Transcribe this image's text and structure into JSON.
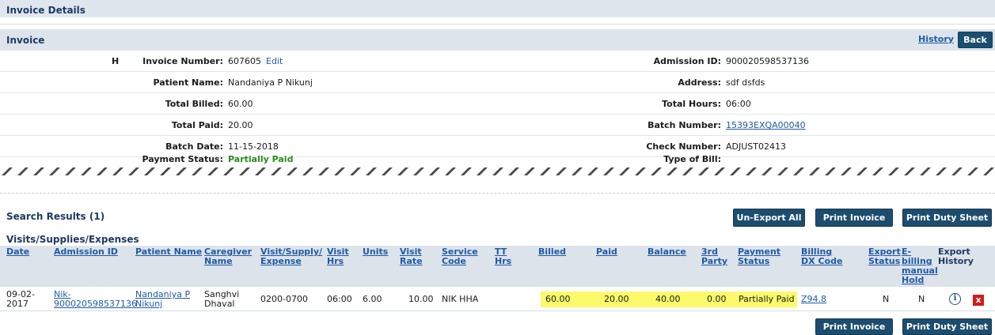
{
  "header": {
    "title": "Invoice Details"
  },
  "invoice_panel": {
    "title": "Invoice",
    "history_link": "History",
    "back_button": "Back"
  },
  "details": {
    "h_mark": "H",
    "invoice_number_label": "Invoice Number:",
    "invoice_number": "607605",
    "edit_link": "Edit",
    "admission_id_label": "Admission ID:",
    "admission_id": "900020598537136",
    "patient_name_label": "Patient Name:",
    "patient_name": "Nandaniya P Nikunj",
    "address_label": "Address:",
    "address": "sdf dsfds",
    "total_billed_label": "Total Billed:",
    "total_billed": "60.00",
    "total_hours_label": "Total Hours:",
    "total_hours": "06:00",
    "total_paid_label": "Total Paid:",
    "total_paid": "20.00",
    "batch_number_label": "Batch Number:",
    "batch_number": "15393EXQA00040",
    "batch_date_label": "Batch Date:",
    "batch_date": "11-15-2018",
    "check_number_label": "Check Number:",
    "check_number": "ADJUST02413",
    "payment_status_label": "Payment Status:",
    "payment_status": "Partially Paid",
    "type_of_bill_label": "Type of Bill:",
    "type_of_bill": ""
  },
  "search": {
    "title": "Search Results",
    "count": "(1)",
    "unexport_all": "Un-Export All",
    "print_invoice": "Print Invoice",
    "print_duty_sheet": "Print Duty Sheet"
  },
  "grid": {
    "section_title": "Visits/Supplies/Expenses",
    "headers": {
      "date": "Date",
      "admission_id": "Admission ID",
      "patient_name": "Patient Name",
      "caregiver_1": "Caregiver",
      "caregiver_2": "Name",
      "visit_supply_1": "Visit/Supply/",
      "visit_supply_2": "Expense",
      "visit_hrs_1": "Visit",
      "visit_hrs_2": "Hrs",
      "units": "Units",
      "visit_rate_1": "Visit",
      "visit_rate_2": "Rate",
      "service_code_1": "Service",
      "service_code_2": "Code",
      "tt_hrs_1": "TT",
      "tt_hrs_2": "Hrs",
      "billed": "Billed",
      "paid": "Paid",
      "balance": "Balance",
      "third_party_1": "3rd",
      "third_party_2": "Party",
      "payment_status_1": "Payment",
      "payment_status_2": "Status",
      "billing_dx_1": "Billing",
      "billing_dx_2": "DX Code",
      "export_status_1": "Export",
      "export_status_2": "Status",
      "ebilling_1": "E-",
      "ebilling_2": "billing",
      "ebilling_3": "manual",
      "ebilling_4": "Hold",
      "export_history_1": "Export",
      "export_history_2": "History"
    },
    "row": {
      "date_1": "09-02-",
      "date_2": "2017",
      "admission_id_1": "Nik-",
      "admission_id_2": "900020598537136",
      "patient_1": "Nandaniya P",
      "patient_2": "Nikunj",
      "caregiver_1": "Sanghvi",
      "caregiver_2": "Dhaval",
      "visit_supply": "0200-0700",
      "visit_hrs": "06:00",
      "units": "6.00",
      "visit_rate": "10.00",
      "service_code": "NIK HHA",
      "tt_hrs": "",
      "billed": "60.00",
      "paid": "20.00",
      "balance": "40.00",
      "third_party": "0.00",
      "payment_status": "Partially Paid",
      "billing_dx": "Z94.8",
      "export_status": "N",
      "ebilling_hold": "N",
      "info_icon": "i",
      "delete_icon": "x"
    }
  },
  "footer": {
    "print_invoice": "Print Invoice",
    "print_duty_sheet": "Print Duty Sheet"
  },
  "colors": {
    "button_dark": "#1d4d6e",
    "highlight": "#fbfa6b",
    "link": "#1f5aa8",
    "status_green": "#2b8a1f",
    "delete_red": "#d21c1c"
  }
}
